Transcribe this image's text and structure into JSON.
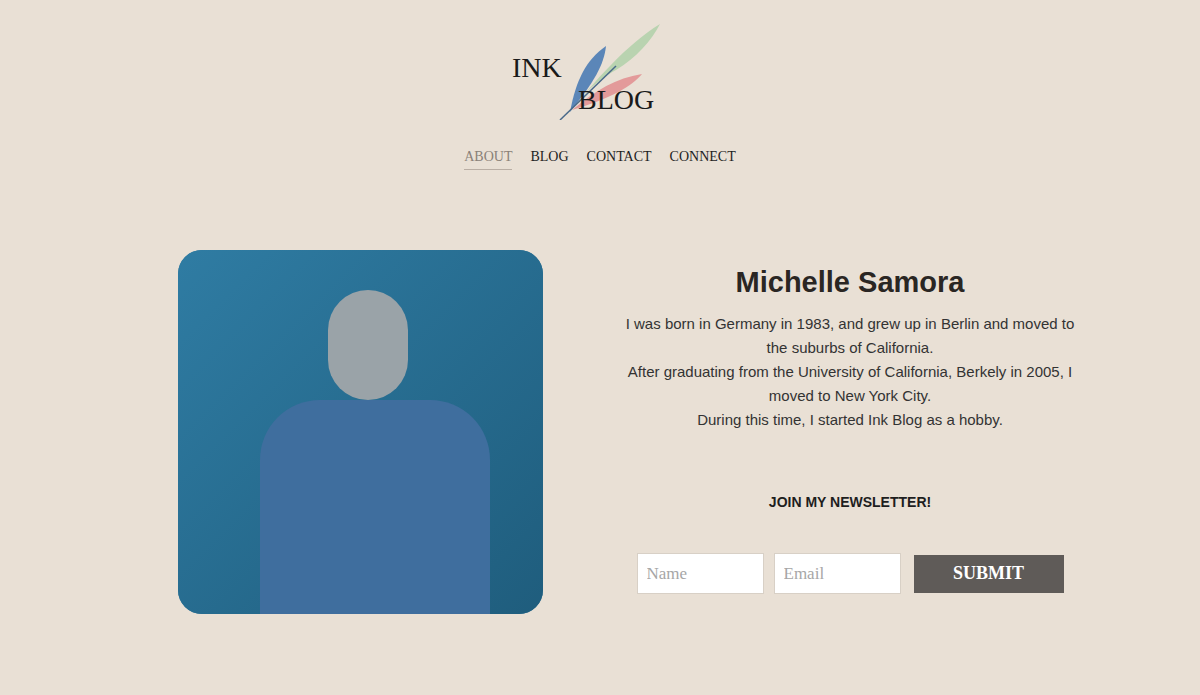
{
  "logo": {
    "line1": "INK",
    "line2": "BLOG"
  },
  "nav": [
    {
      "label": "ABOUT",
      "selected": true
    },
    {
      "label": "BLOG",
      "selected": false
    },
    {
      "label": "CONTACT",
      "selected": false
    },
    {
      "label": "CONNECT",
      "selected": false
    }
  ],
  "profile": {
    "name": "Michelle Samora",
    "paragraphs": [
      "I was born in Germany in 1983, and grew up in Berlin and moved to the suburbs of California.",
      "After graduating from the University of California, Berkely in 2005, I moved to New York City.",
      "During this time, I started Ink Blog as a hobby."
    ]
  },
  "newsletter": {
    "heading": "JOIN MY NEWSLETTER!",
    "fields": [
      {
        "placeholder": "Name"
      },
      {
        "placeholder": "Email"
      }
    ],
    "button": "SUBMIT"
  }
}
